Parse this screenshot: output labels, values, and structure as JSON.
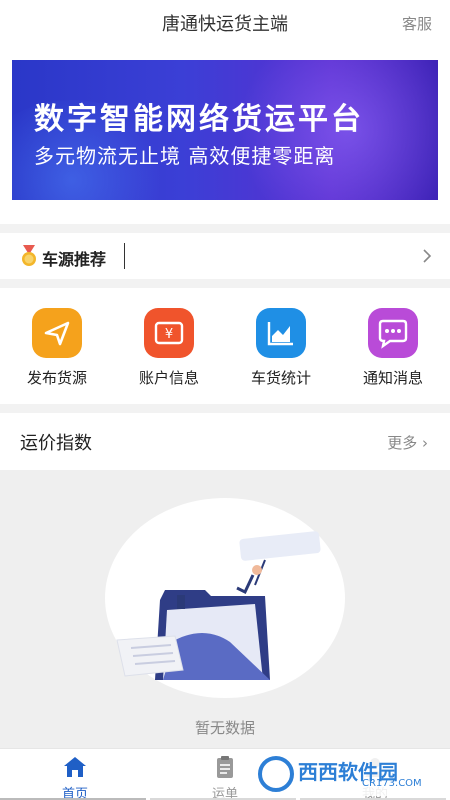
{
  "header": {
    "title": "唐通快运货主端",
    "service_label": "客服"
  },
  "banner": {
    "line1": "数字智能网络货运平台",
    "line2": "多元物流无止境  高效便捷零距离"
  },
  "recommend": {
    "label": "车源推荐"
  },
  "quick_actions": [
    {
      "label": "发布货源",
      "icon": "send-icon",
      "color": "#f5a21c"
    },
    {
      "label": "账户信息",
      "icon": "ticket-yuan-icon",
      "color": "#f0542c"
    },
    {
      "label": "车货统计",
      "icon": "area-chart-icon",
      "color": "#1f8fe5"
    },
    {
      "label": "通知消息",
      "icon": "chat-bubble-icon",
      "color": "#b94bd8"
    }
  ],
  "price_index": {
    "title": "运价指数",
    "more_label": "更多"
  },
  "empty_state": {
    "text": "暂无数据"
  },
  "tabs": [
    {
      "label": "首页",
      "icon": "home-icon",
      "active": true
    },
    {
      "label": "运单",
      "icon": "clipboard-icon",
      "active": false
    },
    {
      "label": "我的",
      "icon": "user-icon",
      "active": false
    }
  ],
  "watermark": {
    "text": "西西软件园",
    "sub": "CR173.COM"
  }
}
